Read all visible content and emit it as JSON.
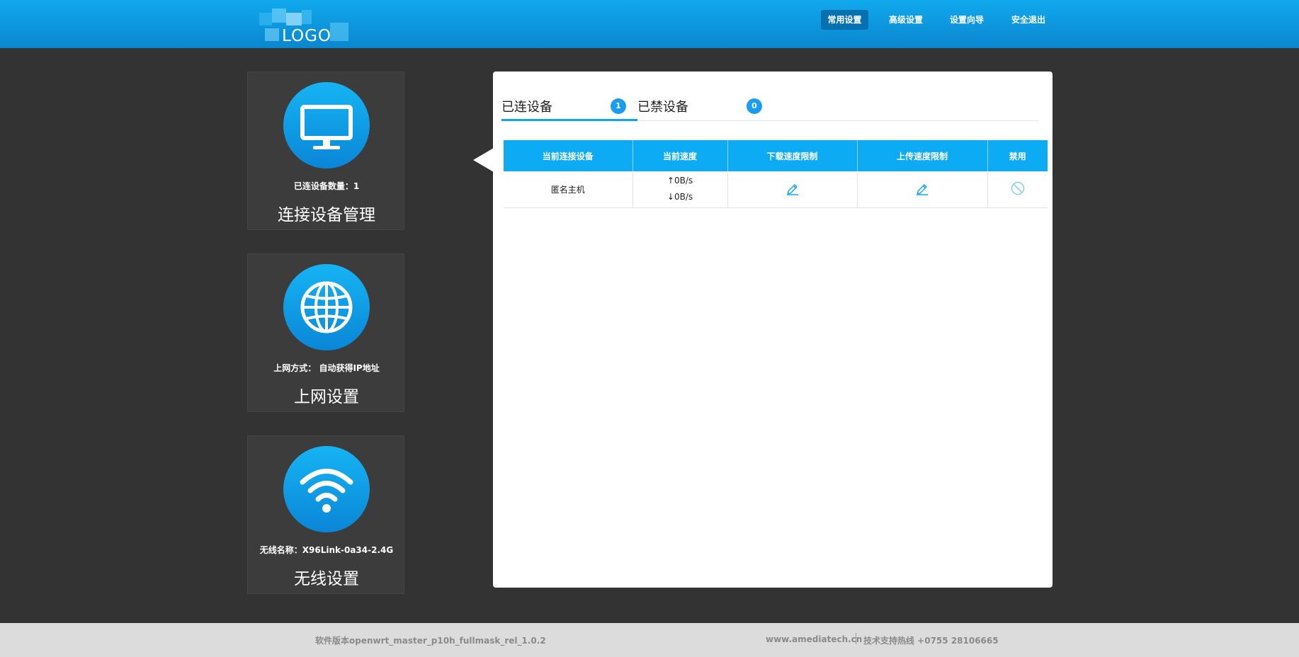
{
  "header": {
    "logo_text": "LOGO",
    "nav": [
      {
        "label": "常用设置",
        "active": true
      },
      {
        "label": "高级设置",
        "active": false
      },
      {
        "label": "设置向导",
        "active": false
      },
      {
        "label": "安全退出",
        "active": false
      }
    ]
  },
  "sidebar": {
    "cards": [
      {
        "icon": "monitor-icon",
        "info": "已连设备数量：1",
        "title": "连接设备管理"
      },
      {
        "icon": "globe-icon",
        "info": "上网方式： 自动获得IP地址",
        "title": "上网设置"
      },
      {
        "icon": "wifi-icon",
        "info": "无线名称：X96Link-0a34-2.4G",
        "title": "无线设置"
      }
    ]
  },
  "main": {
    "tabs": [
      {
        "label": "已连设备",
        "count": "1",
        "active": true
      },
      {
        "label": "已禁设备",
        "count": "0",
        "active": false
      }
    ],
    "table": {
      "headers": [
        "当前连接设备",
        "当前速度",
        "下载速度限制",
        "上传速度限制",
        "禁用"
      ],
      "rows": [
        {
          "device": "匿名主机",
          "up_speed": "↑0B/s",
          "down_speed": "↓0B/s",
          "download_limit_icon": "edit-icon",
          "upload_limit_icon": "edit-icon",
          "disable_icon": "ban-icon"
        }
      ]
    }
  },
  "footer": {
    "version": "软件版本openwrt_master_p10h_fullmask_rel_1.0.2",
    "website": "www.amediatech.cn",
    "hotline": "技术支持热线 +0755 28106665"
  },
  "colors": {
    "accent": "#0eabf5",
    "header_top": "#11a9ee",
    "background": "#333333"
  }
}
